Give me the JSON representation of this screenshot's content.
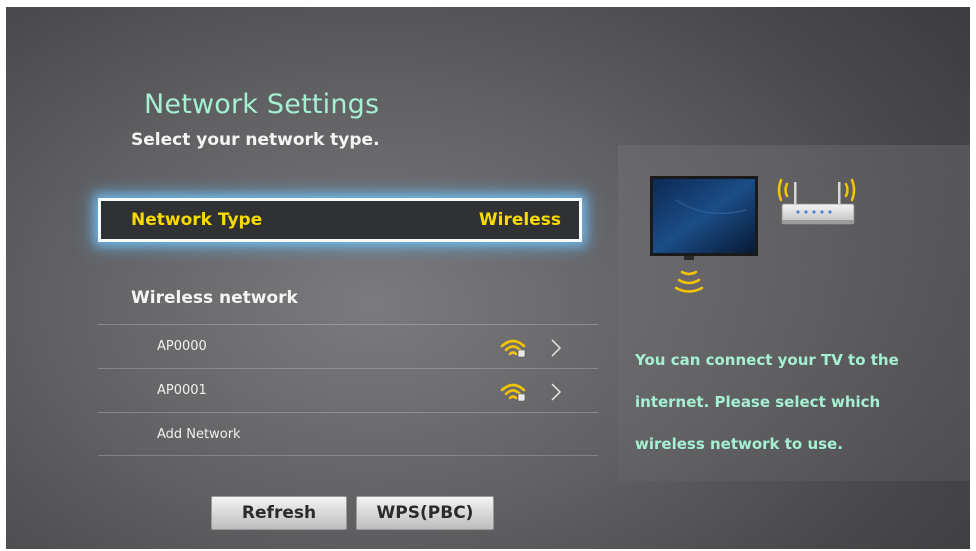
{
  "page": {
    "title": "Network Settings",
    "subtitle": "Select your network type."
  },
  "network_type": {
    "label": "Network Type",
    "value": "Wireless"
  },
  "wireless": {
    "section_label": "Wireless network",
    "networks": [
      {
        "name": "AP0000",
        "icon": "wifi-secured-icon"
      },
      {
        "name": "AP0001",
        "icon": "wifi-secured-icon"
      }
    ],
    "add_network_label": "Add Network"
  },
  "info_text": "You can connect your TV to the internet. Please select which wireless network to use.",
  "buttons": {
    "refresh": "Refresh",
    "wps": "WPS(PBC)"
  },
  "colors": {
    "title": "#a6f0d2",
    "highlight_text": "#f8d900",
    "focus_glow": "#78c8ff",
    "signal": "#f5c400"
  }
}
